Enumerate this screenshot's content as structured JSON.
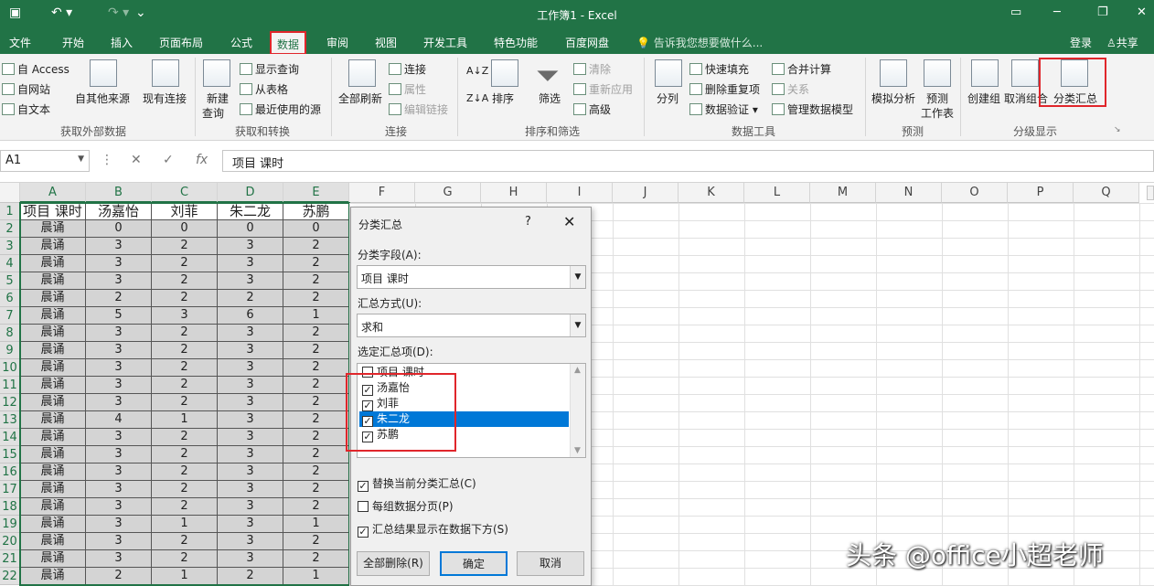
{
  "title": "工作簿1 - Excel",
  "quick_access": {
    "save_icon": "save-icon",
    "undo_icon": "undo-icon",
    "redo_icon": "redo-icon",
    "customize_icon": "customize-icon"
  },
  "tabs": [
    "文件",
    "开始",
    "插入",
    "页面布局",
    "公式",
    "数据",
    "审阅",
    "视图",
    "开发工具",
    "特色功能",
    "百度网盘"
  ],
  "active_tab": "数据",
  "tell_me": "告诉我您想要做什么...",
  "login": "登录",
  "share": "共享",
  "ribbon": {
    "get_external": {
      "access": "自 Access",
      "web": "自网站",
      "text": "自文本",
      "other": "自其他来源",
      "existing": "现有连接",
      "label": "获取外部数据"
    },
    "get_transform": {
      "new_query": "新建",
      "new_query2": "查询",
      "show_query": "显示查询",
      "from_table": "从表格",
      "recent": "最近使用的源",
      "label": "获取和转换"
    },
    "connections": {
      "refresh_all": "全部刷新",
      "connections": "连接",
      "properties": "属性",
      "edit_links": "编辑链接",
      "label": "连接"
    },
    "sort_filter": {
      "sort": "排序",
      "filter": "筛选",
      "clear": "清除",
      "reapply": "重新应用",
      "advanced": "高级",
      "label": "排序和筛选"
    },
    "data_tools": {
      "split": "分列",
      "flash_fill": "快速填充",
      "remove_dup": "删除重复项",
      "validation": "数据验证",
      "consolidate": "合并计算",
      "relations": "关系",
      "model": "管理数据模型",
      "label": "数据工具"
    },
    "forecast": {
      "whatif": "模拟分析",
      "sheet1": "预测",
      "sheet2": "工作表",
      "label": "预测"
    },
    "outline": {
      "group": "创建组",
      "ungroup": "取消组合",
      "subtotal": "分类汇总",
      "label": "分级显示"
    }
  },
  "name_box": "A1",
  "formula": "项目 课时",
  "columns": [
    "A",
    "B",
    "C",
    "D",
    "E",
    "F",
    "G",
    "H",
    "I",
    "J",
    "K",
    "L",
    "M",
    "N",
    "O",
    "P",
    "Q"
  ],
  "header_row": [
    "项目 课时",
    "汤嘉怡",
    "刘菲",
    "朱二龙",
    "苏鹏"
  ],
  "rows": [
    [
      "晨诵",
      "0",
      "0",
      "0",
      "0"
    ],
    [
      "晨诵",
      "3",
      "2",
      "3",
      "2"
    ],
    [
      "晨诵",
      "3",
      "2",
      "3",
      "2"
    ],
    [
      "晨诵",
      "3",
      "2",
      "3",
      "2"
    ],
    [
      "晨诵",
      "2",
      "2",
      "2",
      "2"
    ],
    [
      "晨诵",
      "5",
      "3",
      "6",
      "1"
    ],
    [
      "晨诵",
      "3",
      "2",
      "3",
      "2"
    ],
    [
      "晨诵",
      "3",
      "2",
      "3",
      "2"
    ],
    [
      "晨诵",
      "3",
      "2",
      "3",
      "2"
    ],
    [
      "晨诵",
      "3",
      "2",
      "3",
      "2"
    ],
    [
      "晨诵",
      "3",
      "2",
      "3",
      "2"
    ],
    [
      "晨诵",
      "4",
      "1",
      "3",
      "2"
    ],
    [
      "晨诵",
      "3",
      "2",
      "3",
      "2"
    ],
    [
      "晨诵",
      "3",
      "2",
      "3",
      "2"
    ],
    [
      "晨诵",
      "3",
      "2",
      "3",
      "2"
    ],
    [
      "晨诵",
      "3",
      "2",
      "3",
      "2"
    ],
    [
      "晨诵",
      "3",
      "2",
      "3",
      "2"
    ],
    [
      "晨诵",
      "3",
      "1",
      "3",
      "1"
    ],
    [
      "晨诵",
      "3",
      "2",
      "3",
      "2"
    ],
    [
      "晨诵",
      "3",
      "2",
      "3",
      "2"
    ],
    [
      "晨诵",
      "2",
      "1",
      "2",
      "1"
    ]
  ],
  "row_numbers": [
    "1",
    "2",
    "3",
    "4",
    "5",
    "6",
    "7",
    "8",
    "9",
    "10",
    "11",
    "12",
    "13",
    "14",
    "15",
    "16",
    "17",
    "18",
    "19",
    "20",
    "21",
    "22"
  ],
  "dialog": {
    "title": "分类汇总",
    "help": "?",
    "close": "✕",
    "field_label": "分类字段(A):",
    "field_value": "项目 课时",
    "method_label": "汇总方式(U):",
    "method_value": "求和",
    "items_label": "选定汇总项(D):",
    "items": [
      {
        "label": "项目 课时",
        "checked": false,
        "selected": false
      },
      {
        "label": "汤嘉怡",
        "checked": true,
        "selected": false
      },
      {
        "label": "刘菲",
        "checked": true,
        "selected": false
      },
      {
        "label": "朱二龙",
        "checked": true,
        "selected": true
      },
      {
        "label": "苏鹏",
        "checked": true,
        "selected": false
      }
    ],
    "replace_current": "替换当前分类汇总(C)",
    "page_break": "每组数据分页(P)",
    "summary_below": "汇总结果显示在数据下方(S)",
    "replace_checked": true,
    "page_break_checked": false,
    "summary_below_checked": true,
    "remove_all": "全部删除(R)",
    "ok": "确定",
    "cancel": "取消"
  },
  "watermark": "头条 @office小超老师"
}
